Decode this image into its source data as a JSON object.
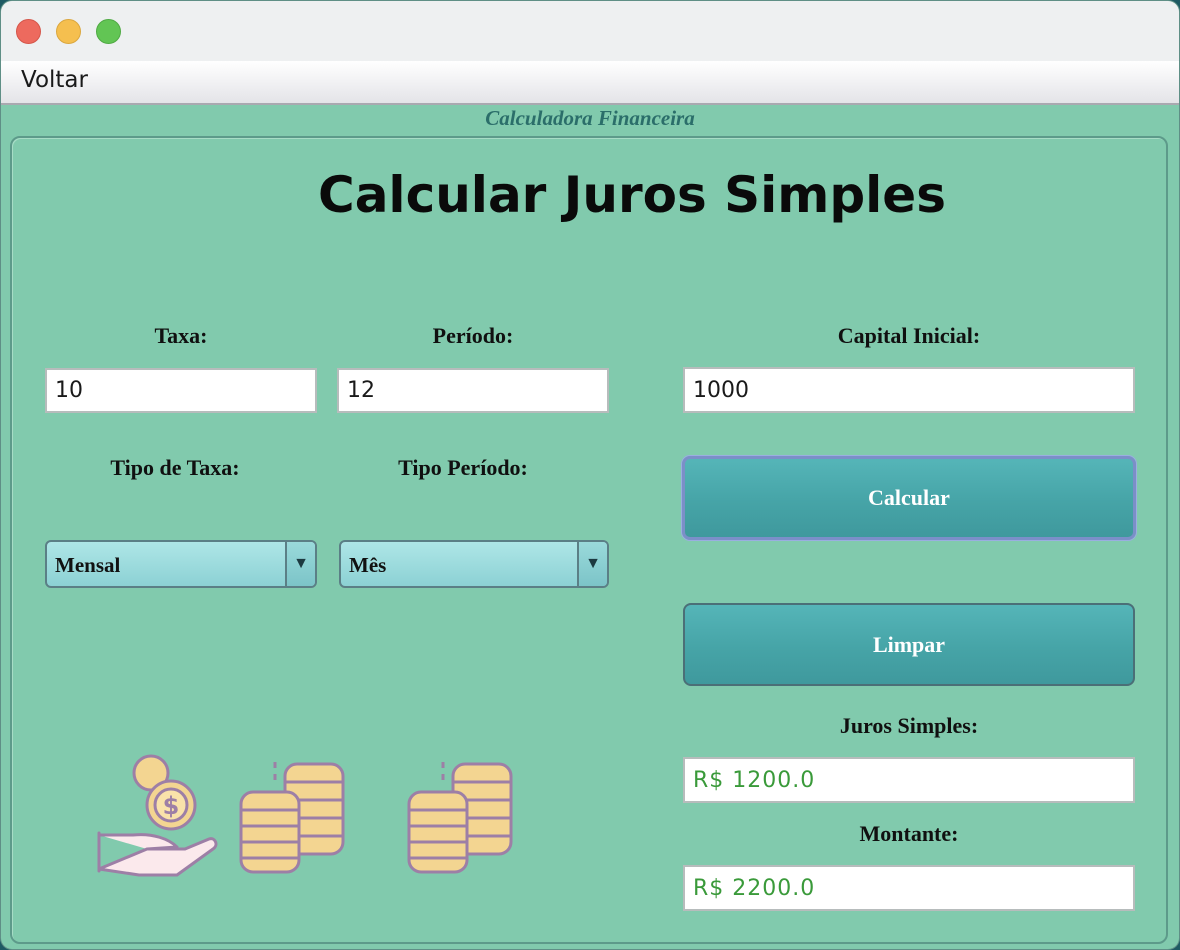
{
  "menu": {
    "items": [
      "Voltar"
    ]
  },
  "frame": {
    "title": "Calculadora Financeira"
  },
  "main": {
    "heading": "Calcular Juros Simples",
    "taxa": {
      "label": "Taxa:",
      "value": "10"
    },
    "periodo": {
      "label": "Período:",
      "value": "12"
    },
    "capital": {
      "label": "Capital Inicial:",
      "value": "1000"
    },
    "tipo_taxa": {
      "label": "Tipo de Taxa:",
      "selected": "Mensal"
    },
    "tipo_periodo": {
      "label": "Tipo Período:",
      "selected": "Mês"
    },
    "buttons": {
      "calcular": "Calcular",
      "limpar": "Limpar"
    },
    "juros": {
      "label": "Juros Simples:",
      "value": "R$ 1200.0"
    },
    "montante": {
      "label": "Montante:",
      "value": "R$ 2200.0"
    }
  },
  "icons": [
    "hand-coins-icon",
    "coin-stacks-icon",
    "coin-stacks-icon"
  ],
  "colors": {
    "background": "#81caad",
    "button": "#46a4a7",
    "result_text": "#3a9a3a",
    "border_title": "#2b6e6a"
  }
}
